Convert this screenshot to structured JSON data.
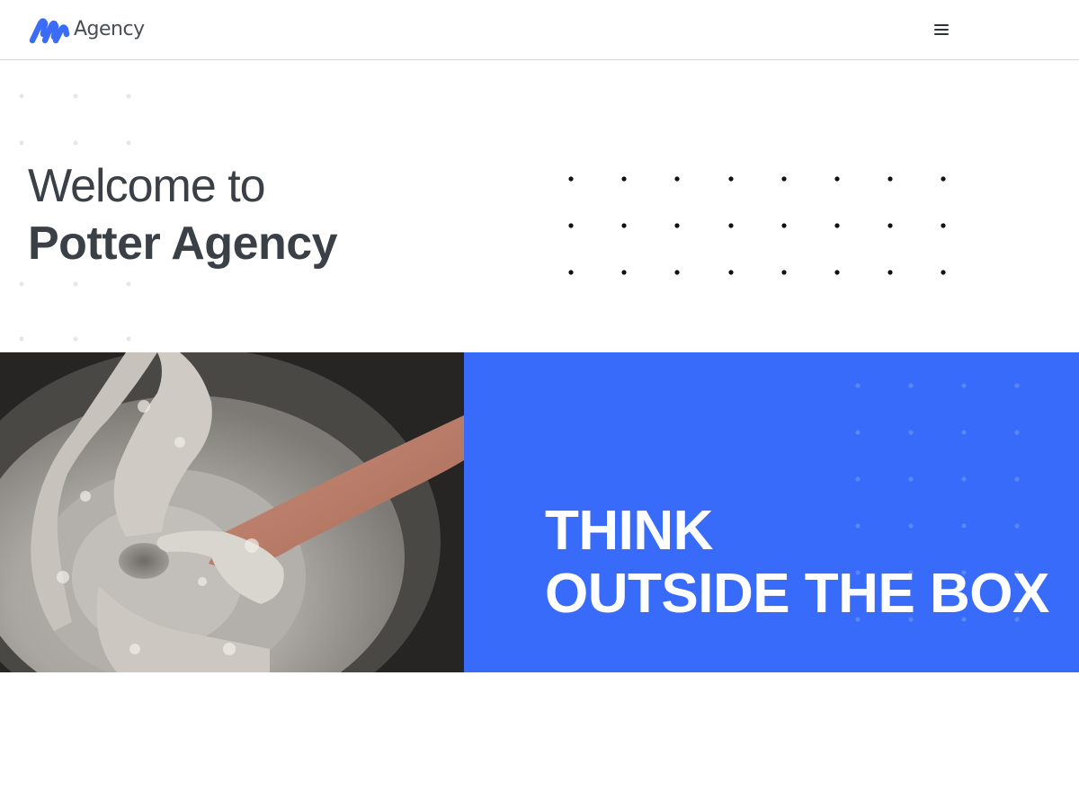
{
  "header": {
    "logo_text": "Agency",
    "menu_icon": "hamburger-menu-icon"
  },
  "hero": {
    "title_line1": "Welcome to",
    "title_line2": "Potter Agency"
  },
  "feature": {
    "image": "pottery-hands-image",
    "tagline_line1": "THINK",
    "tagline_line2": "OUTSIDE THE BOX"
  },
  "colors": {
    "brand_blue": "#386bfa",
    "heading_text": "#3b4047",
    "logo_mark": "#3b6cf8"
  }
}
